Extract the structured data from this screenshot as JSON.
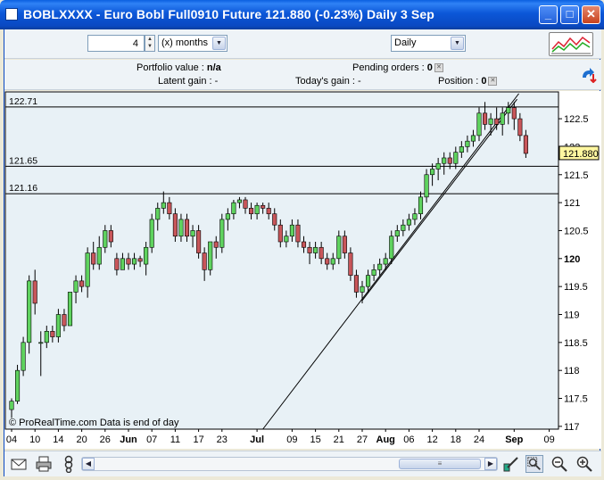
{
  "window": {
    "title": "BOBLXXXX - Euro Bobl Full0910 Future      121.880 (-0.23%)      Daily  3 Sep",
    "min_glyph": "_",
    "max_glyph": "□",
    "close_glyph": "✕"
  },
  "toolbar": {
    "period_value": "4",
    "unit_label": "(x) months",
    "interval_label": "Daily"
  },
  "infobar": {
    "portfolio_label": "Portfolio value :",
    "portfolio_value": "n/a",
    "pending_label": "Pending orders :",
    "pending_value": "0",
    "latent_label": "Latent gain :",
    "latent_value": "-",
    "today_label": "Today's gain :",
    "today_value": "-",
    "position_label": "Position :",
    "position_value": "0"
  },
  "chart_data": {
    "type": "candlestick",
    "watermark": "© ProRealTime.com  Data is end of day",
    "last_price": "121.880",
    "ylim": [
      116.95,
      122.98
    ],
    "y_ticks": [
      117,
      117.5,
      118,
      118.5,
      119,
      119.5,
      120,
      120.5,
      121,
      121.5,
      122,
      122.5
    ],
    "y_tick_labels": [
      "117",
      "117.5",
      "118",
      "118.5",
      "119",
      "119.5",
      "120",
      "120.5",
      "121",
      "121.5",
      "122",
      "122.5"
    ],
    "y_bold_tick": 120,
    "x_labels": [
      {
        "i": 0,
        "label": "04",
        "bold": false
      },
      {
        "i": 4,
        "label": "10",
        "bold": false
      },
      {
        "i": 8,
        "label": "14",
        "bold": false
      },
      {
        "i": 12,
        "label": "20",
        "bold": false
      },
      {
        "i": 16,
        "label": "26",
        "bold": false
      },
      {
        "i": 20,
        "label": "Jun",
        "bold": true
      },
      {
        "i": 24,
        "label": "07",
        "bold": false
      },
      {
        "i": 28,
        "label": "11",
        "bold": false
      },
      {
        "i": 32,
        "label": "17",
        "bold": false
      },
      {
        "i": 36,
        "label": "23",
        "bold": false
      },
      {
        "i": 42,
        "label": "Jul",
        "bold": true
      },
      {
        "i": 48,
        "label": "09",
        "bold": false
      },
      {
        "i": 52,
        "label": "15",
        "bold": false
      },
      {
        "i": 56,
        "label": "21",
        "bold": false
      },
      {
        "i": 60,
        "label": "27",
        "bold": false
      },
      {
        "i": 64,
        "label": "Aug",
        "bold": true
      },
      {
        "i": 68,
        "label": "06",
        "bold": false
      },
      {
        "i": 72,
        "label": "12",
        "bold": false
      },
      {
        "i": 76,
        "label": "18",
        "bold": false
      },
      {
        "i": 80,
        "label": "24",
        "bold": false
      },
      {
        "i": 86,
        "label": "Sep",
        "bold": true
      },
      {
        "i": 92,
        "label": "09",
        "bold": false
      }
    ],
    "hlines": [
      {
        "value": 122.71,
        "label": "122.71"
      },
      {
        "value": 121.65,
        "label": "121.65"
      },
      {
        "value": 121.16,
        "label": "121.16"
      }
    ],
    "trendlines": [
      {
        "i1": 43,
        "v1": 116.95,
        "i2": 86.8,
        "v2": 122.95
      },
      {
        "i1": 60,
        "v1": 119.25,
        "i2": 86.5,
        "v2": 122.85
      }
    ],
    "candles": [
      [
        117.3,
        117.5,
        117.15,
        117.45
      ],
      [
        117.45,
        118.1,
        117.4,
        118.0
      ],
      [
        118.0,
        118.6,
        117.9,
        118.5
      ],
      [
        118.5,
        119.7,
        118.3,
        119.6
      ],
      [
        119.6,
        119.8,
        119.0,
        119.2
      ],
      [
        118.5,
        118.7,
        117.9,
        118.5
      ],
      [
        118.5,
        118.8,
        118.4,
        118.7
      ],
      [
        118.7,
        118.8,
        118.5,
        118.6
      ],
      [
        118.6,
        119.1,
        118.5,
        119.0
      ],
      [
        119.0,
        119.1,
        118.7,
        118.8
      ],
      [
        118.8,
        119.4,
        118.8,
        119.4
      ],
      [
        119.4,
        119.7,
        119.2,
        119.6
      ],
      [
        119.6,
        119.7,
        119.4,
        119.5
      ],
      [
        119.5,
        120.2,
        119.3,
        120.1
      ],
      [
        120.1,
        120.3,
        119.8,
        119.9
      ],
      [
        119.9,
        120.4,
        119.8,
        120.2
      ],
      [
        120.2,
        120.6,
        120.1,
        120.5
      ],
      [
        120.5,
        120.6,
        120.2,
        120.3
      ],
      [
        120.0,
        120.1,
        119.7,
        119.8
      ],
      [
        119.8,
        120.1,
        119.8,
        120.0
      ],
      [
        120.0,
        120.1,
        119.8,
        119.9
      ],
      [
        119.9,
        120.1,
        119.8,
        120.0
      ],
      [
        120.0,
        120.05,
        119.85,
        119.95
      ],
      [
        119.9,
        120.3,
        119.7,
        120.2
      ],
      [
        120.2,
        120.8,
        120.1,
        120.7
      ],
      [
        120.7,
        121.0,
        120.5,
        120.9
      ],
      [
        120.9,
        121.2,
        120.8,
        121.0
      ],
      [
        121.0,
        121.1,
        120.7,
        120.8
      ],
      [
        120.8,
        120.9,
        120.3,
        120.4
      ],
      [
        120.4,
        120.8,
        120.3,
        120.7
      ],
      [
        120.7,
        120.8,
        120.3,
        120.4
      ],
      [
        120.4,
        120.6,
        120.2,
        120.5
      ],
      [
        120.5,
        120.6,
        120.0,
        120.1
      ],
      [
        120.1,
        120.2,
        119.6,
        119.8
      ],
      [
        119.8,
        120.3,
        119.7,
        120.3
      ],
      [
        120.3,
        120.4,
        120.0,
        120.2
      ],
      [
        120.2,
        120.8,
        120.1,
        120.7
      ],
      [
        120.7,
        120.9,
        120.5,
        120.8
      ],
      [
        120.8,
        121.05,
        120.7,
        121.0
      ],
      [
        121.0,
        121.1,
        120.9,
        121.05
      ],
      [
        121.05,
        121.1,
        120.8,
        120.9
      ],
      [
        120.9,
        121.0,
        120.7,
        120.8
      ],
      [
        120.8,
        121.0,
        120.7,
        120.95
      ],
      [
        120.95,
        121.0,
        120.8,
        120.9
      ],
      [
        120.9,
        121.0,
        120.7,
        120.8
      ],
      [
        120.8,
        120.9,
        120.5,
        120.6
      ],
      [
        120.6,
        120.7,
        120.2,
        120.3
      ],
      [
        120.3,
        120.5,
        120.2,
        120.4
      ],
      [
        120.4,
        120.7,
        120.3,
        120.6
      ],
      [
        120.6,
        120.7,
        120.2,
        120.3
      ],
      [
        120.3,
        120.4,
        120.1,
        120.2
      ],
      [
        120.2,
        120.3,
        119.9,
        120.1
      ],
      [
        120.1,
        120.3,
        120.0,
        120.2
      ],
      [
        120.2,
        120.3,
        119.9,
        120.0
      ],
      [
        120.0,
        120.1,
        119.8,
        119.9
      ],
      [
        119.9,
        120.1,
        119.8,
        120.0
      ],
      [
        120.0,
        120.5,
        119.9,
        120.4
      ],
      [
        120.4,
        120.5,
        120.0,
        120.1
      ],
      [
        120.1,
        120.2,
        119.6,
        119.7
      ],
      [
        119.7,
        119.8,
        119.3,
        119.4
      ],
      [
        119.4,
        119.6,
        119.2,
        119.5
      ],
      [
        119.5,
        119.8,
        119.4,
        119.7
      ],
      [
        119.7,
        119.9,
        119.6,
        119.8
      ],
      [
        119.8,
        120.0,
        119.7,
        119.9
      ],
      [
        119.9,
        120.1,
        119.8,
        120.0
      ],
      [
        120.0,
        120.5,
        119.9,
        120.4
      ],
      [
        120.4,
        120.6,
        120.3,
        120.5
      ],
      [
        120.5,
        120.7,
        120.4,
        120.6
      ],
      [
        120.6,
        120.8,
        120.5,
        120.7
      ],
      [
        120.7,
        120.9,
        120.6,
        120.8
      ],
      [
        120.8,
        121.2,
        120.7,
        121.1
      ],
      [
        121.1,
        121.6,
        121.0,
        121.5
      ],
      [
        121.5,
        121.7,
        121.3,
        121.6
      ],
      [
        121.6,
        121.8,
        121.4,
        121.7
      ],
      [
        121.7,
        121.9,
        121.5,
        121.8
      ],
      [
        121.8,
        121.9,
        121.6,
        121.7
      ],
      [
        121.7,
        122.0,
        121.6,
        121.9
      ],
      [
        121.9,
        122.1,
        121.8,
        122.0
      ],
      [
        122.0,
        122.2,
        121.9,
        122.1
      ],
      [
        122.1,
        122.3,
        122.0,
        122.2
      ],
      [
        122.2,
        122.7,
        122.1,
        122.6
      ],
      [
        122.6,
        122.8,
        122.3,
        122.4
      ],
      [
        122.4,
        122.6,
        122.2,
        122.5
      ],
      [
        122.5,
        122.7,
        122.3,
        122.4
      ],
      [
        122.4,
        122.7,
        122.2,
        122.6
      ],
      [
        122.6,
        122.8,
        122.4,
        122.7
      ],
      [
        122.7,
        122.8,
        122.3,
        122.5
      ],
      [
        122.5,
        122.6,
        122.1,
        122.2
      ],
      [
        122.2,
        122.3,
        121.8,
        121.88
      ]
    ],
    "colors": {
      "up": "#5fd35f",
      "down": "#c8565a",
      "line": "#000000",
      "price_tag_bg": "#fff7a0"
    }
  },
  "bottombar": {
    "scroll_left": "◀",
    "scroll_right": "▶",
    "thumb_grip": "≡"
  }
}
